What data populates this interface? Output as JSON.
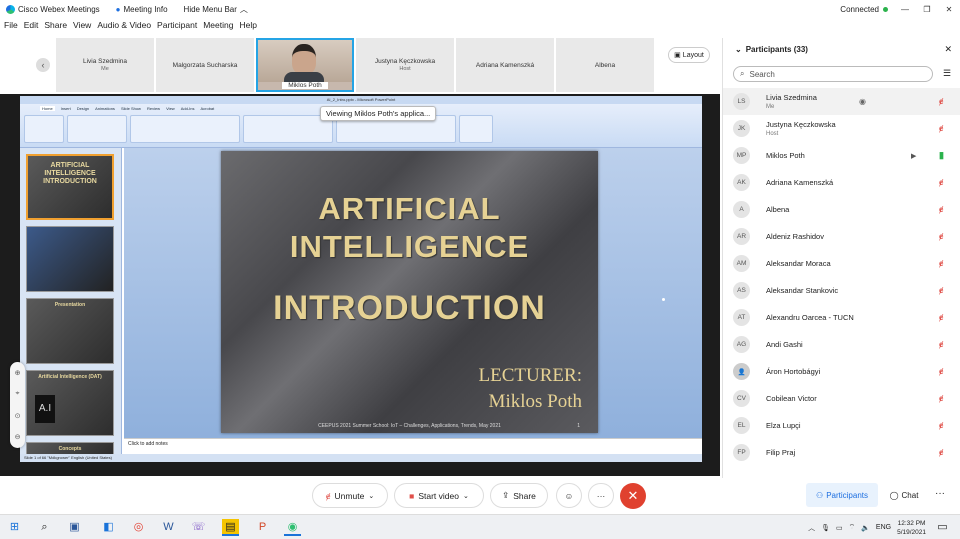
{
  "window": {
    "app_title": "Cisco Webex Meetings",
    "meeting_info": "Meeting Info",
    "hide_menu": "Hide Menu Bar",
    "status": "Connected",
    "minimize": "—",
    "restore": "❐",
    "close": "✕"
  },
  "menu": [
    "File",
    "Edit",
    "Share",
    "View",
    "Audio & Video",
    "Participant",
    "Meeting",
    "Help"
  ],
  "strip": {
    "tiles": [
      {
        "name": "Livia Szedmina",
        "sub": "Me"
      },
      {
        "name": "Malgorzata Sucharska",
        "sub": ""
      },
      {
        "name": "Miklos Poth",
        "sub": ""
      },
      {
        "name": "Justyna Kęczkowska",
        "sub": "Host"
      },
      {
        "name": "Adriana Kamenszká",
        "sub": ""
      },
      {
        "name": "Albena",
        "sub": ""
      }
    ],
    "layout_label": "Layout"
  },
  "share": {
    "viewing_label": "Viewing Miklos Poth's applica...",
    "ppt_title": "AI_2_Intro.pptx - Microsoft PowerPoint",
    "ribbon_tabs": [
      "Home",
      "Insert",
      "Design",
      "Animations",
      "Slide Show",
      "Review",
      "View",
      "Add-Ins",
      "Acrobat"
    ],
    "thumb_titles": [
      "ARTIFICIAL INTELLIGENCE INTRODUCTION",
      "",
      "Presentation",
      "Artificial Intelligence (DAT)",
      "Concepts"
    ],
    "notes_placeholder": "Click to add notes",
    "status_text": "Slide 1 of 66   \"Mdkgrower\"   English (United States)",
    "slide": {
      "title_line1": "ARTIFICIAL",
      "title_line2": "INTELLIGENCE",
      "title_line3": "INTRODUCTION",
      "lecturer_label": "LECTURER:",
      "lecturer_name": "Miklos Poth",
      "footer": "CEEPUS 2021 Summer School: IoT – Challenges, Applications, Trends, May 2021",
      "page_num": "1"
    }
  },
  "participants": {
    "header": "Participants (33)",
    "search_placeholder": "Search",
    "list": [
      {
        "initials": "LS",
        "name": "Livia Szedmina",
        "role": "Me",
        "mic": "off"
      },
      {
        "initials": "JK",
        "name": "Justyna Kęczkowska",
        "role": "Host",
        "mic": "off"
      },
      {
        "initials": "MP",
        "name": "Miklos Poth",
        "role": "",
        "mic": "on"
      },
      {
        "initials": "AK",
        "name": "Adriana Kamenszká",
        "role": "",
        "mic": "off"
      },
      {
        "initials": "A",
        "name": "Albena",
        "role": "",
        "mic": "off"
      },
      {
        "initials": "AR",
        "name": "Aldeniz Rashidov",
        "role": "",
        "mic": "off"
      },
      {
        "initials": "AM",
        "name": "Aleksandar Moraca",
        "role": "",
        "mic": "off"
      },
      {
        "initials": "AS",
        "name": "Aleksandar Stankovic",
        "role": "",
        "mic": "off"
      },
      {
        "initials": "AT",
        "name": "Alexandru Oarcea - TUCN",
        "role": "",
        "mic": "off"
      },
      {
        "initials": "AG",
        "name": "Andi Gashi",
        "role": "",
        "mic": "off"
      },
      {
        "initials": "",
        "name": "Áron Hortobágyi",
        "role": "",
        "mic": "off"
      },
      {
        "initials": "CV",
        "name": "Cobilean Victor",
        "role": "",
        "mic": "off"
      },
      {
        "initials": "EL",
        "name": "Elza Lupçi",
        "role": "",
        "mic": "off"
      },
      {
        "initials": "FP",
        "name": "Filip Praj",
        "role": "",
        "mic": "off"
      }
    ]
  },
  "controls": {
    "unmute": "Unmute",
    "start_video": "Start video",
    "share": "Share",
    "participants": "Participants",
    "chat": "Chat"
  },
  "taskbar": {
    "lang": "ENG",
    "time": "12:32 PM",
    "date": "5/19/2021"
  }
}
